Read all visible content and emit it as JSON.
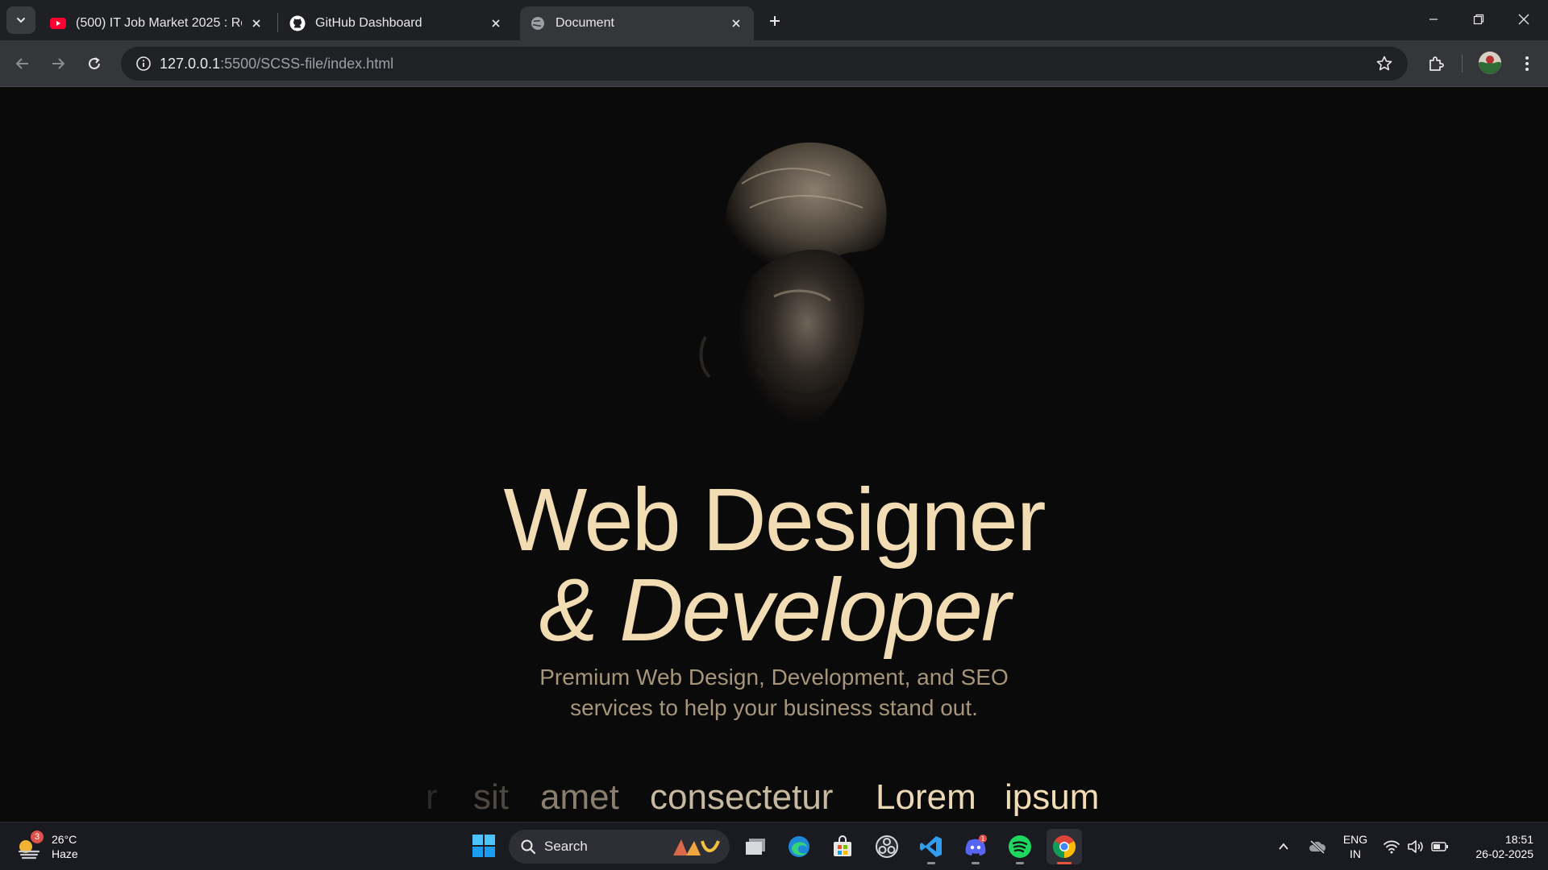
{
  "browser": {
    "tabs": [
      {
        "title": "(500) IT Job Market 2025 : Recru",
        "favicon": "youtube-icon"
      },
      {
        "title": "GitHub Dashboard",
        "favicon": "github-icon"
      },
      {
        "title": "Document",
        "favicon": "globe-icon",
        "active": true
      }
    ],
    "url_host": "127.0.0.1",
    "url_rest": ":5500/SCSS-file/index.html"
  },
  "page": {
    "title_line1": "Web Designer",
    "title_line2": "& Developer",
    "subtitle_line1": "Premium Web Design, Development, and SEO",
    "subtitle_line2": "services to help your business stand out.",
    "marquee": [
      "r",
      "sit",
      "amet",
      "consectetur",
      "Lorem",
      "ipsum"
    ],
    "colors": {
      "accent": "#f1dcb4",
      "muted": "#a6957a",
      "background": "#0b0a0a"
    }
  },
  "taskbar": {
    "weather_temp": "26°C",
    "weather_desc": "Haze",
    "weather_badge": "3",
    "search_label": "Search",
    "discord_badge": "1",
    "lang_line1": "ENG",
    "lang_line2": "IN",
    "time": "18:51",
    "date": "26-02-2025"
  }
}
